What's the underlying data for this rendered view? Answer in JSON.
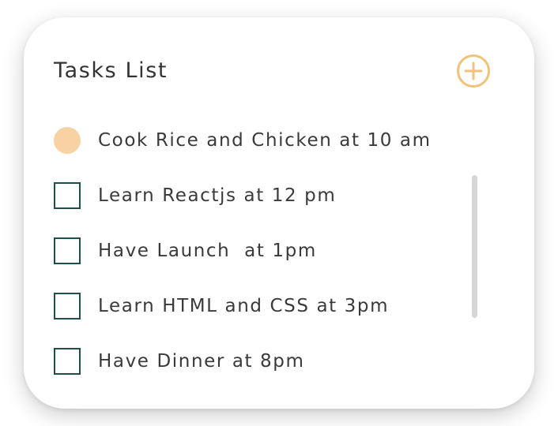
{
  "header": {
    "title": "Tasks List",
    "add_icon": "plus-circle-icon"
  },
  "colors": {
    "accent": "#f0c27a",
    "done_marker": "#f8d2a3",
    "checkbox_border": "#1f4f4c",
    "text": "#3a3a3a"
  },
  "tasks": [
    {
      "label": "Cook Rice and Chicken at 10 am",
      "done": true
    },
    {
      "label": "Learn Reactjs at 12 pm",
      "done": false
    },
    {
      "label": "Have Launch  at 1pm",
      "done": false
    },
    {
      "label": "Learn HTML and CSS at 3pm",
      "done": false
    },
    {
      "label": "Have Dinner at 8pm",
      "done": false
    }
  ]
}
